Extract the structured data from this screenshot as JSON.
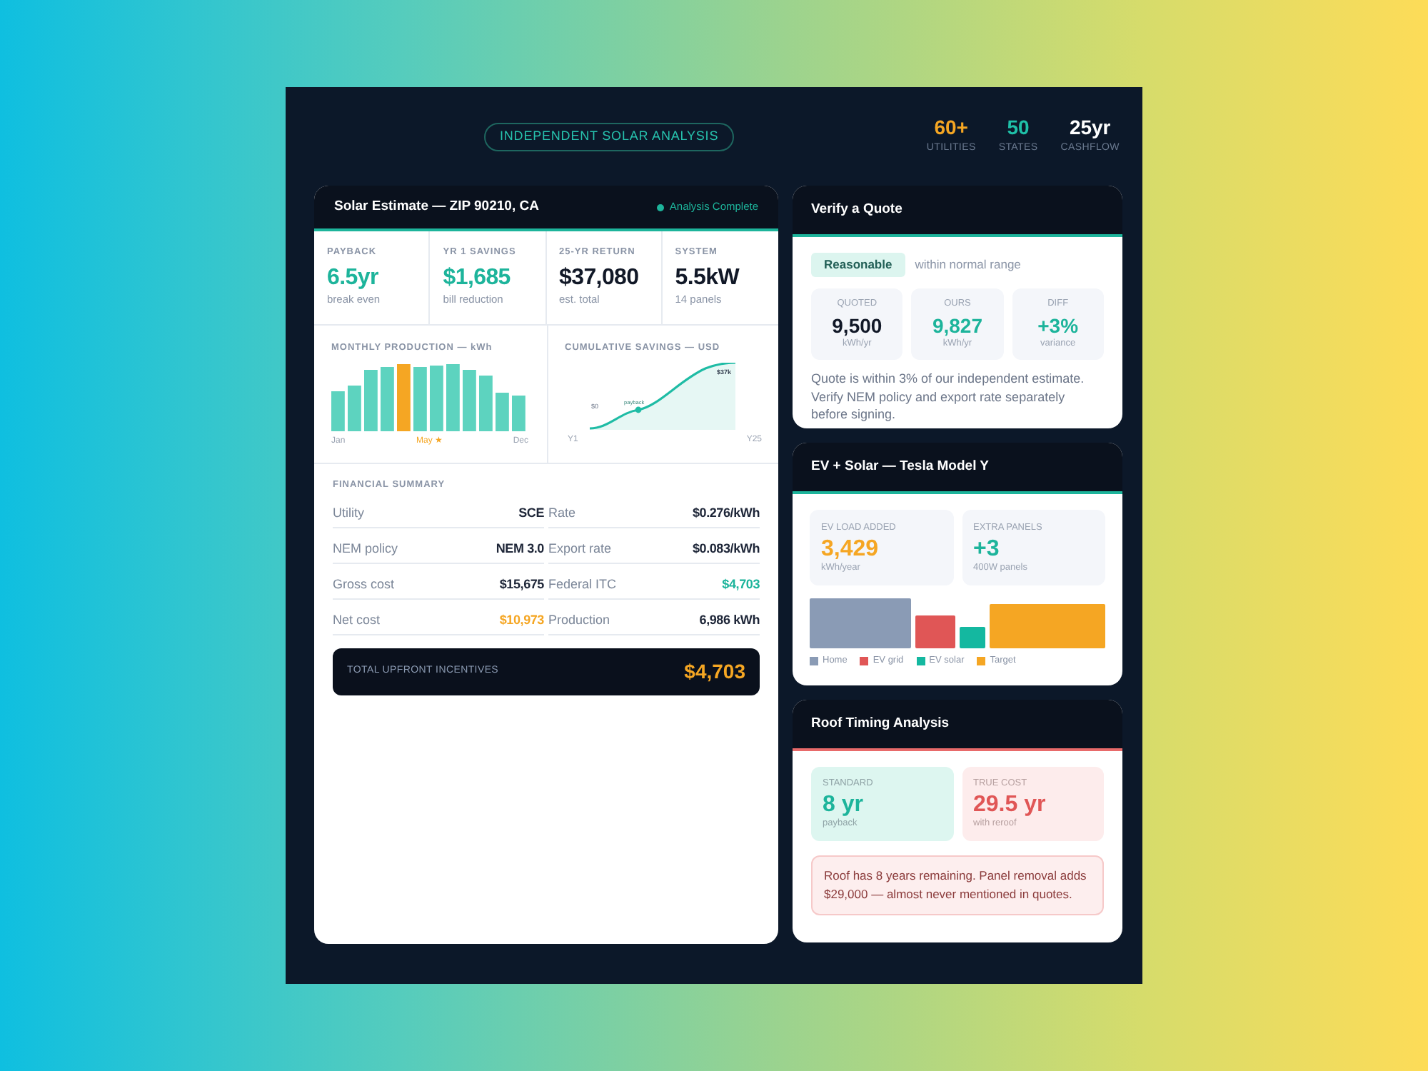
{
  "header": {
    "badge": "INDEPENDENT SOLAR ANALYSIS",
    "stats": [
      {
        "value": "60+",
        "label": "UTILITIES",
        "color": "#f5a623"
      },
      {
        "value": "50",
        "label": "STATES",
        "color": "#1fc0a8"
      },
      {
        "value": "25yr",
        "label": "CASHFLOW",
        "color": "#ffffff"
      }
    ]
  },
  "estimate": {
    "title": "Solar Estimate — ZIP 90210, CA",
    "status": "Analysis Complete",
    "metrics": [
      {
        "label": "PAYBACK",
        "value": "6.5yr",
        "note": "break even",
        "color": "#1db49b"
      },
      {
        "label": "YR 1 SAVINGS",
        "value": "$1,685",
        "note": "bill reduction",
        "color": "#1db49b"
      },
      {
        "label": "25-YR RETURN",
        "value": "$37,080",
        "note": "est. total",
        "color": "#111827"
      },
      {
        "label": "SYSTEM",
        "value": "5.5kW",
        "note": "14 panels",
        "color": "#111827"
      }
    ],
    "production_chart": {
      "title": "MONTHLY PRODUCTION — kWh",
      "bars": [
        {
          "highlighted": false
        },
        {
          "highlighted": false
        },
        {
          "highlighted": false
        },
        {
          "highlighted": false
        },
        {
          "highlighted": true
        },
        {
          "highlighted": false
        },
        {
          "highlighted": false
        },
        {
          "highlighted": false
        },
        {
          "highlighted": false
        },
        {
          "highlighted": false
        },
        {
          "highlighted": false
        },
        {
          "highlighted": false
        }
      ],
      "x_labels": [
        {
          "label": "Jan",
          "color": "#9aa3b2"
        },
        {
          "label": "May ★",
          "color": "#f5a623"
        },
        {
          "label": "Dec",
          "color": "#9aa3b2"
        }
      ]
    },
    "savings_chart": {
      "title": "CUMULATIVE SAVINGS — USD",
      "zero_label": "$0",
      "marker_label": "payback",
      "end_label": "$37k",
      "x_start": "Y1",
      "x_end": "Y25"
    },
    "financial_summary": {
      "title": "FINANCIAL SUMMARY",
      "rows": [
        {
          "label": "Utility",
          "value": "SCE",
          "color": "#1e2638"
        },
        {
          "label": "Rate",
          "value": "$0.276/kWh",
          "color": "#1e2638"
        },
        {
          "label": "NEM policy",
          "value": "NEM 3.0",
          "color": "#1e2638"
        },
        {
          "label": "Export rate",
          "value": "$0.083/kWh",
          "color": "#1e2638"
        },
        {
          "label": "Gross cost",
          "value": "$15,675",
          "color": "#1e2638"
        },
        {
          "label": "Federal ITC",
          "value": "$4,703",
          "color": "#1db49b"
        },
        {
          "label": "Net cost",
          "value": "$10,973",
          "color": "#f5a623"
        },
        {
          "label": "Production",
          "value": "6,986 kWh",
          "color": "#1e2638"
        }
      ]
    },
    "total": {
      "label": "TOTAL UPFRONT INCENTIVES",
      "value": "$4,703"
    }
  },
  "quote": {
    "title": "Verify a Quote",
    "verdict": "Reasonable",
    "verdict_note": "within normal range",
    "stats": [
      {
        "label": "QUOTED",
        "value": "9,500",
        "unit": "kWh/yr",
        "color": "#111827"
      },
      {
        "label": "OURS",
        "value": "9,827",
        "unit": "kWh/yr",
        "color": "#1db49b"
      },
      {
        "label": "DIFF",
        "value": "+3%",
        "unit": "variance",
        "color": "#1db49b"
      }
    ],
    "note": "Quote is within 3% of our independent estimate. Verify NEM policy and export rate separately before signing."
  },
  "ev": {
    "title": "EV + Solar — Tesla Model Y",
    "stats": [
      {
        "label": "EV LOAD ADDED",
        "value": "3,429",
        "unit": "kWh/year",
        "color": "#f5a623"
      },
      {
        "label": "EXTRA PANELS",
        "value": "+3",
        "unit": "400W panels",
        "color": "#1db49b"
      }
    ],
    "legend": [
      {
        "label": "Home",
        "color": "#8a9bb5"
      },
      {
        "label": "EV grid",
        "color": "#e05656"
      },
      {
        "label": "EV solar",
        "color": "#14b8a0"
      },
      {
        "label": "Target",
        "color": "#f5a623"
      }
    ]
  },
  "roof": {
    "title": "Roof Timing Analysis",
    "tiles": [
      {
        "kind": "good",
        "label": "STANDARD",
        "value": "8 yr",
        "note": "payback"
      },
      {
        "kind": "bad",
        "label": "TRUE COST",
        "value": "29.5 yr",
        "note": "with reroof"
      }
    ],
    "warning": "Roof has 8 years remaining. Panel removal adds $29,000 — almost never mentioned in quotes."
  }
}
